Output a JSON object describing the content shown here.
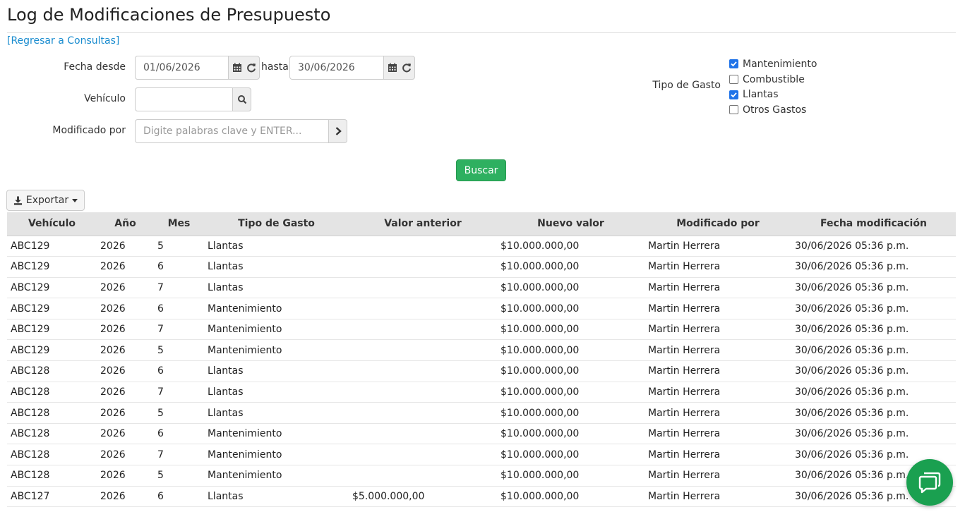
{
  "page": {
    "title": "Log de Modificaciones de Presupuesto",
    "back_link": "[Regresar a Consultas]"
  },
  "filters": {
    "fecha_desde_label": "Fecha desde",
    "fecha_desde_value": "01/06/2026",
    "hasta_label": "hasta",
    "fecha_hasta_value": "30/06/2026",
    "vehiculo_label": "Vehículo",
    "vehiculo_value": "",
    "modificado_label": "Modificado por",
    "modificado_placeholder": "Digite palabras clave y ENTER...",
    "tipo_gasto_label": "Tipo de Gasto",
    "tipo_gasto_options": [
      {
        "label": "Mantenimiento",
        "checked": true
      },
      {
        "label": "Combustible",
        "checked": false
      },
      {
        "label": "Llantas",
        "checked": true
      },
      {
        "label": "Otros Gastos",
        "checked": false
      }
    ],
    "search_button": "Buscar"
  },
  "toolbar": {
    "export_label": "Exportar"
  },
  "table": {
    "columns": [
      "Vehículo",
      "Año",
      "Mes",
      "Tipo de Gasto",
      "Valor anterior",
      "Nuevo valor",
      "Modificado por",
      "Fecha modificación"
    ],
    "rows": [
      [
        "ABC129",
        "2026",
        "5",
        "Llantas",
        "",
        "$10.000.000,00",
        "Martin Herrera",
        "30/06/2026 05:36 p.m."
      ],
      [
        "ABC129",
        "2026",
        "6",
        "Llantas",
        "",
        "$10.000.000,00",
        "Martin Herrera",
        "30/06/2026 05:36 p.m."
      ],
      [
        "ABC129",
        "2026",
        "7",
        "Llantas",
        "",
        "$10.000.000,00",
        "Martin Herrera",
        "30/06/2026 05:36 p.m."
      ],
      [
        "ABC129",
        "2026",
        "6",
        "Mantenimiento",
        "",
        "$10.000.000,00",
        "Martin Herrera",
        "30/06/2026 05:36 p.m."
      ],
      [
        "ABC129",
        "2026",
        "7",
        "Mantenimiento",
        "",
        "$10.000.000,00",
        "Martin Herrera",
        "30/06/2026 05:36 p.m."
      ],
      [
        "ABC129",
        "2026",
        "5",
        "Mantenimiento",
        "",
        "$10.000.000,00",
        "Martin Herrera",
        "30/06/2026 05:36 p.m."
      ],
      [
        "ABC128",
        "2026",
        "6",
        "Llantas",
        "",
        "$10.000.000,00",
        "Martin Herrera",
        "30/06/2026 05:36 p.m."
      ],
      [
        "ABC128",
        "2026",
        "7",
        "Llantas",
        "",
        "$10.000.000,00",
        "Martin Herrera",
        "30/06/2026 05:36 p.m."
      ],
      [
        "ABC128",
        "2026",
        "5",
        "Llantas",
        "",
        "$10.000.000,00",
        "Martin Herrera",
        "30/06/2026 05:36 p.m."
      ],
      [
        "ABC128",
        "2026",
        "6",
        "Mantenimiento",
        "",
        "$10.000.000,00",
        "Martin Herrera",
        "30/06/2026 05:36 p.m."
      ],
      [
        "ABC128",
        "2026",
        "7",
        "Mantenimiento",
        "",
        "$10.000.000,00",
        "Martin Herrera",
        "30/06/2026 05:36 p.m."
      ],
      [
        "ABC128",
        "2026",
        "5",
        "Mantenimiento",
        "",
        "$10.000.000,00",
        "Martin Herrera",
        "30/06/2026 05:36 p.m."
      ],
      [
        "ABC127",
        "2026",
        "6",
        "Llantas",
        "$5.000.000,00",
        "$10.000.000,00",
        "Martin Herrera",
        "30/06/2026 05:36 p.m."
      ]
    ]
  },
  "colors": {
    "link": "#1a8ccf",
    "success": "#2eb060",
    "checkbox": "#1f73e8",
    "header_bg": "#e4e4e4"
  },
  "icons": [
    "calendar-icon",
    "refresh-icon",
    "search-icon",
    "chevron-right-icon",
    "download-icon",
    "chat-icon"
  ]
}
